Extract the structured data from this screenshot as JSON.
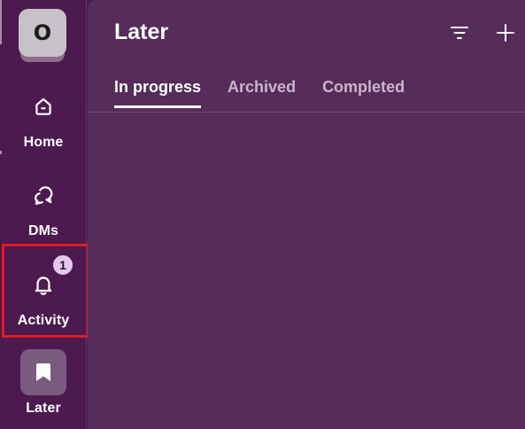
{
  "workspace": {
    "initial": "O"
  },
  "sidebar": {
    "items": [
      {
        "label": "Home",
        "icon": "home-icon"
      },
      {
        "label": "DMs",
        "icon": "chat-bubbles-icon"
      },
      {
        "label": "Activity",
        "icon": "bell-icon",
        "badge": "1"
      },
      {
        "label": "Later",
        "icon": "bookmark-icon",
        "selected": true
      }
    ]
  },
  "main": {
    "title": "Later",
    "tabs": [
      {
        "label": "In progress",
        "active": true
      },
      {
        "label": "Archived"
      },
      {
        "label": "Completed"
      }
    ]
  },
  "colors": {
    "sidebar_bg": "#4c1a4f",
    "main_bg": "#552c5a",
    "badge_bg": "#e3c7ee",
    "highlight": "#e11b22"
  }
}
